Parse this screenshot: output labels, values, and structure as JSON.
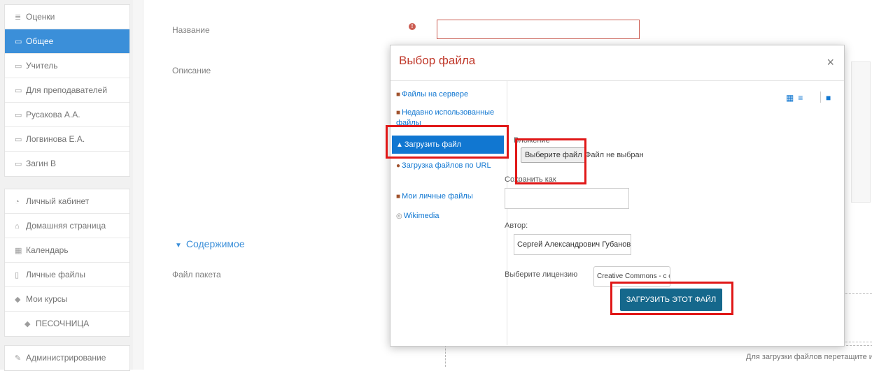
{
  "sidebar": {
    "top_items": [
      {
        "label": "Оценки",
        "icon": "list-icon"
      },
      {
        "label": "Общее",
        "icon": "folder-icon",
        "active": true
      },
      {
        "label": "Учитель",
        "icon": "folder-icon"
      },
      {
        "label": "Для преподавателей",
        "icon": "folder-icon"
      },
      {
        "label": "Русакова А.А.",
        "icon": "folder-icon"
      },
      {
        "label": "Логвинова Е.А.",
        "icon": "folder-icon"
      },
      {
        "label": "Загин В",
        "icon": "folder-icon"
      }
    ],
    "mid_items": [
      {
        "label": "Личный кабинет",
        "icon": "dashboard-icon"
      },
      {
        "label": "Домашняя страница",
        "icon": "home-icon"
      },
      {
        "label": "Календарь",
        "icon": "calendar-icon"
      },
      {
        "label": "Личные файлы",
        "icon": "file-icon"
      },
      {
        "label": "Мои курсы",
        "icon": "graduation-cap-icon"
      },
      {
        "label": "ПЕСОЧНИЦА",
        "icon": "graduation-cap-icon"
      }
    ],
    "admin_item": {
      "label": "Администрирование",
      "icon": "wrench-icon"
    }
  },
  "form": {
    "name_label": "Название",
    "description_label": "Описание",
    "section_title": "Содержимое",
    "package_label": "Файл пакета",
    "drop_hint": "Для загрузки файлов перетащите и"
  },
  "dialog": {
    "title": "Выбор файла",
    "close_glyph": "×",
    "repositories": [
      {
        "label": "Файлы на сервере",
        "icon": "server-icon"
      },
      {
        "label": "Недавно использованные файлы",
        "icon": "recent-icon"
      },
      {
        "label": "Загрузить файл",
        "icon": "upload-icon",
        "active": true
      },
      {
        "label": "Загрузка файлов по URL",
        "icon": "url-icon"
      },
      {
        "label": "Мои личные файлы",
        "icon": "private-files-icon"
      },
      {
        "label": "Wikimedia",
        "icon": "wikimedia-icon"
      }
    ],
    "view_icons": [
      "grid-view-icon",
      "list-view-icon",
      "tree-view-icon"
    ],
    "attachment_label": "Вложение",
    "choose_file_button": "Выберите файл",
    "no_file_text": "Файл не выбран",
    "save_as_label": "Сохранить как",
    "save_as_value": "",
    "author_label": "Автор:",
    "author_value": "Сергей Александрович Губанов",
    "license_label": "Выберите лицензию",
    "license_value": "Creative Commons - с сохр",
    "upload_button": "ЗАГРУЗИТЬ ЭТОТ ФАЙЛ"
  },
  "colors": {
    "accent": "#1177d1",
    "title_red": "#c0392b",
    "upload_button": "#15688c",
    "highlight": "#e01818"
  }
}
